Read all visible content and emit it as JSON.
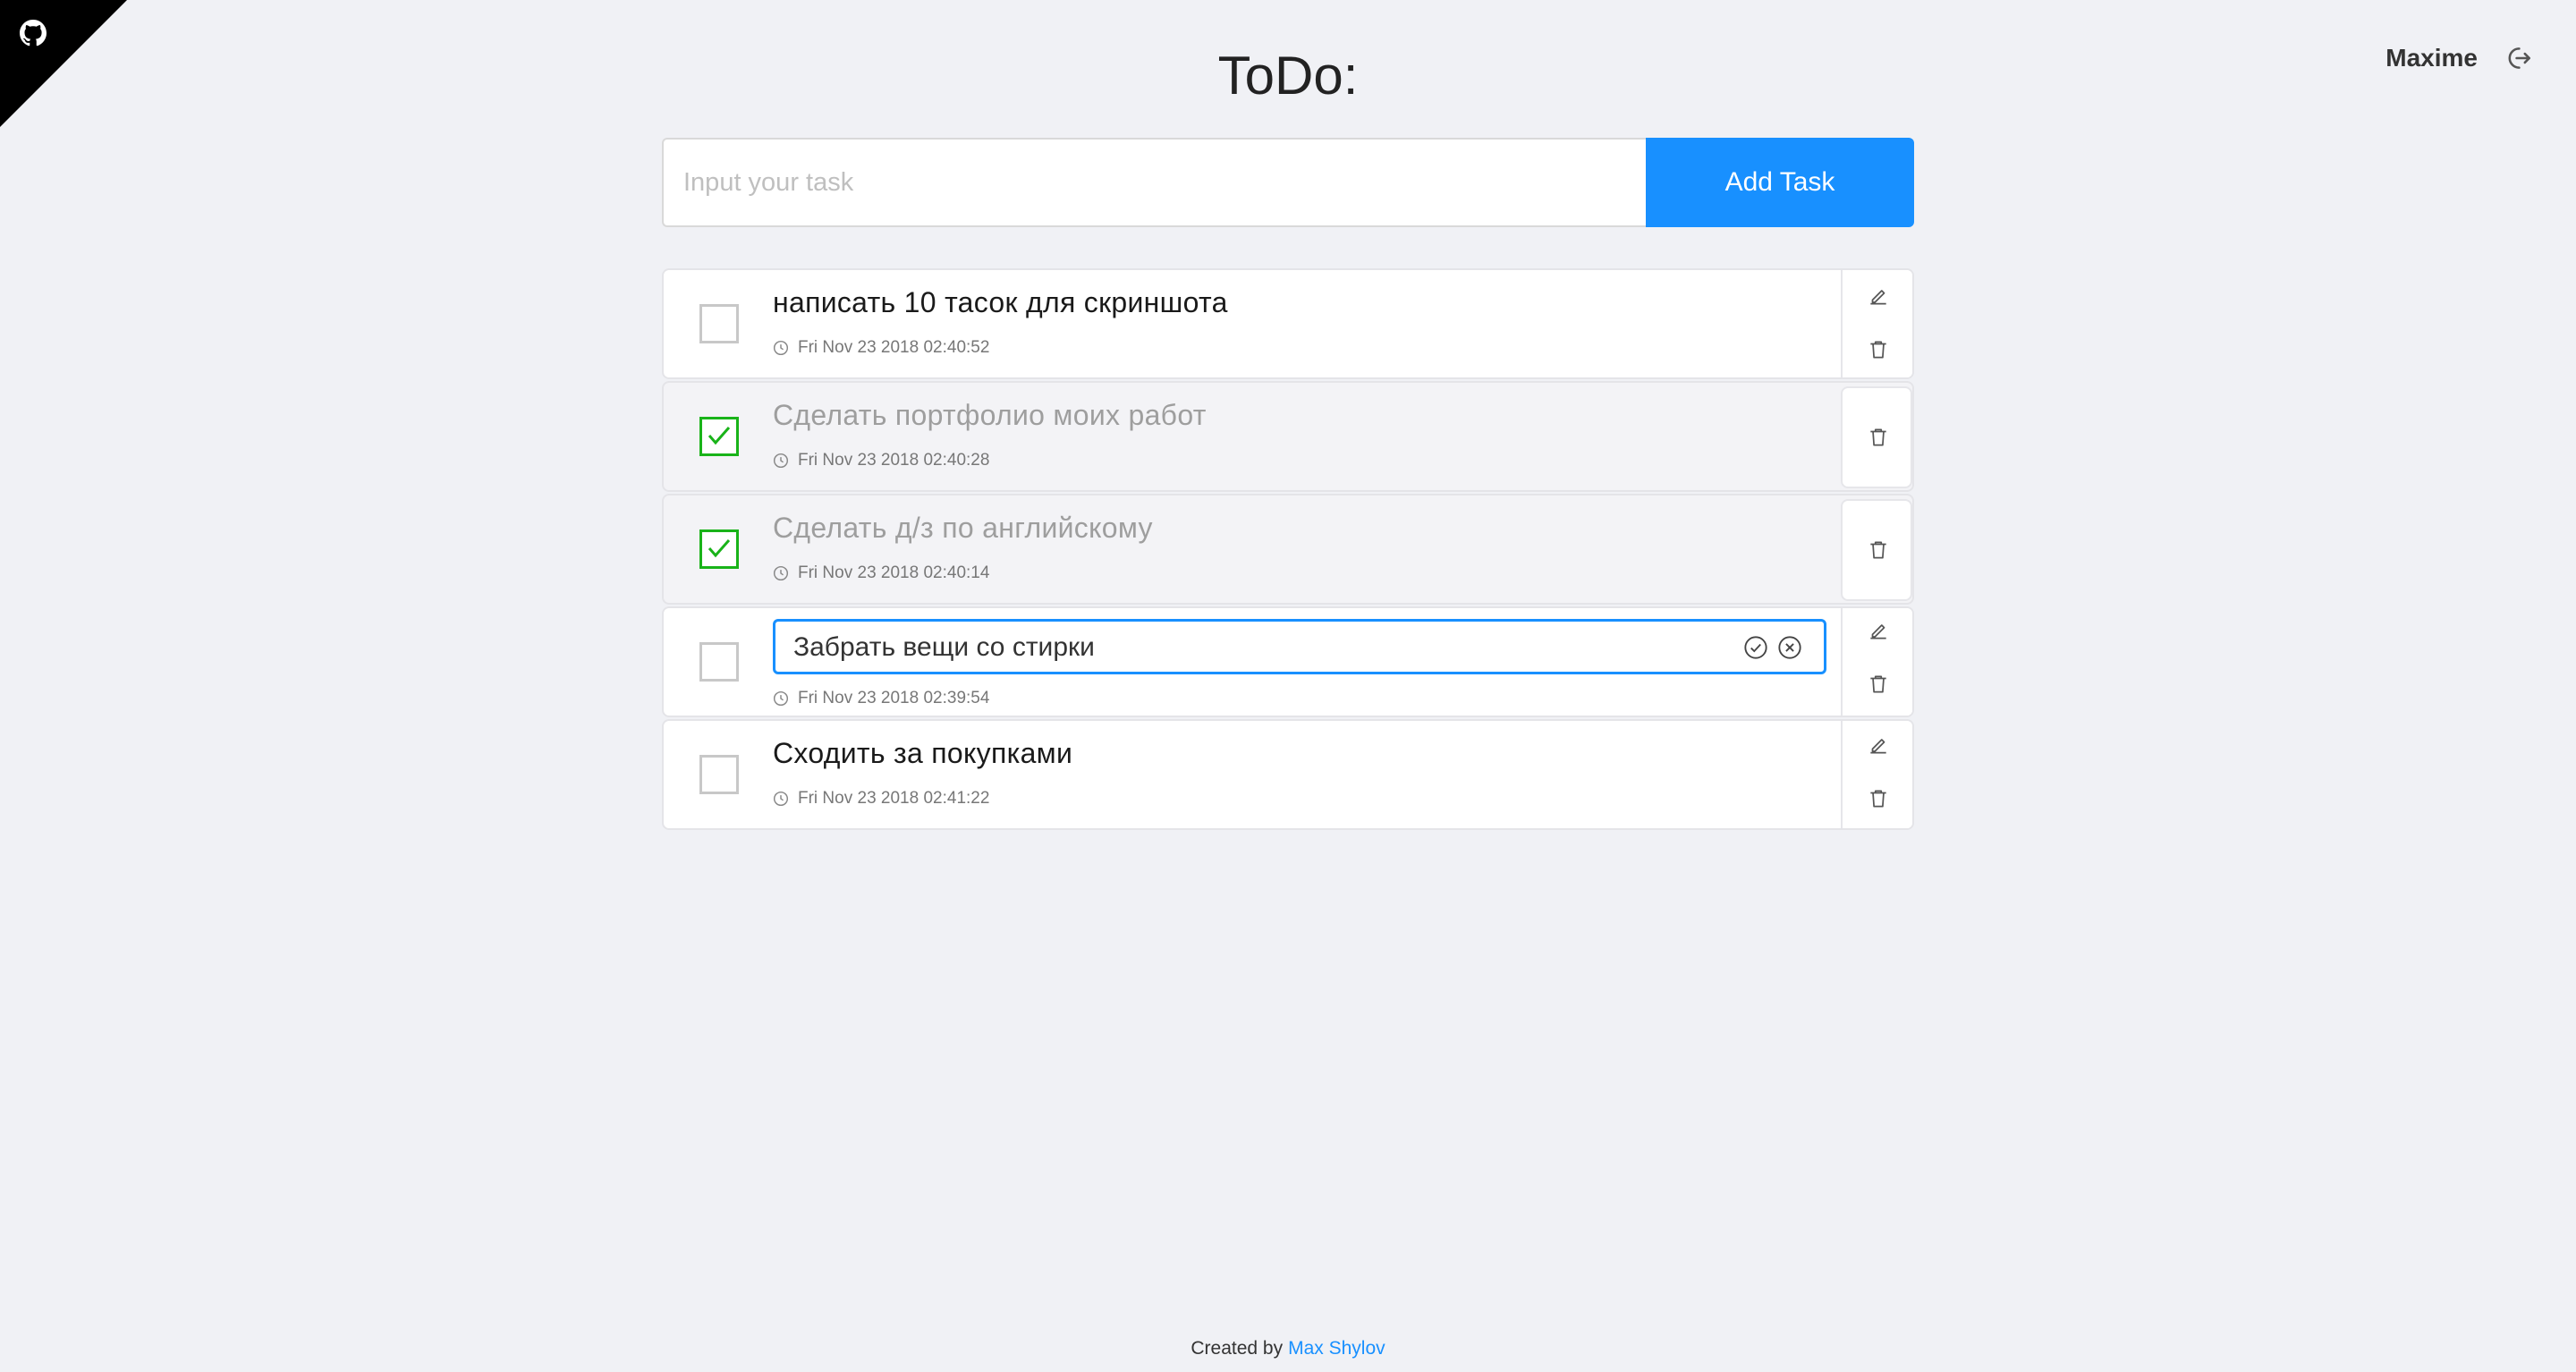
{
  "header": {
    "title": "ToDo:",
    "user_name": "Maxime"
  },
  "add_task": {
    "placeholder": "Input your task",
    "value": "",
    "button_label": "Add Task"
  },
  "tasks": [
    {
      "text": "написать 10 тасок для скриншота",
      "date": "Fri Nov 23 2018 02:40:52",
      "done": false,
      "editing": false
    },
    {
      "text": "Сделать портфолио моих работ",
      "date": "Fri Nov 23 2018 02:40:28",
      "done": true,
      "editing": false
    },
    {
      "text": "Сделать д/з по английскому",
      "date": "Fri Nov 23 2018 02:40:14",
      "done": true,
      "editing": false
    },
    {
      "text": "Забрать вещи со стирки",
      "date": "Fri Nov 23 2018 02:39:54",
      "done": false,
      "editing": true
    },
    {
      "text": "Сходить за покупками",
      "date": "Fri Nov 23 2018 02:41:22",
      "done": false,
      "editing": false
    }
  ],
  "footer": {
    "prefix": "Created by",
    "author": "Max Shylov"
  },
  "colors": {
    "accent": "#1890ff",
    "done_check": "#19b319",
    "corner": "#000000"
  },
  "icons": [
    "github-icon",
    "logout-icon",
    "checkbox-check-icon",
    "clock-icon",
    "edit-pencil-icon",
    "trash-icon",
    "confirm-check-circle-icon",
    "cancel-x-circle-icon"
  ]
}
